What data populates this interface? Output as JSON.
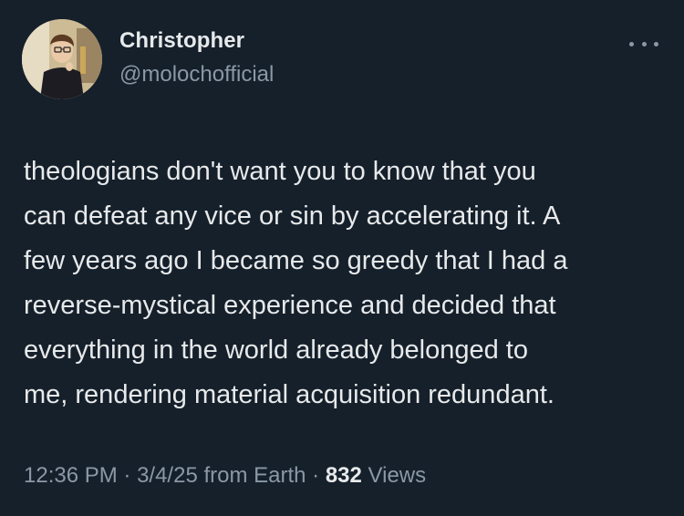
{
  "author": {
    "display_name": "Christopher",
    "handle": "@molochofficial"
  },
  "tweet": {
    "text": "theologians don't want you to know that you\ncan defeat any vice or sin by accelerating it. A\nfew years ago I became so greedy that I had a\nreverse-mystical experience and decided that\neverything in the world already belonged to\nme, rendering material acquisition redundant."
  },
  "meta": {
    "time": "12:36 PM",
    "sep1": " · ",
    "date": "3/4/25",
    "source": " from Earth",
    "sep2": " · ",
    "views_count": "832",
    "views_label": " Views"
  },
  "icons": {
    "more": "more-options-icon",
    "avatar": "profile-photo"
  },
  "colors": {
    "background": "#15202b",
    "primary_text": "#e7e9ea",
    "secondary_text": "#8b98a5"
  }
}
